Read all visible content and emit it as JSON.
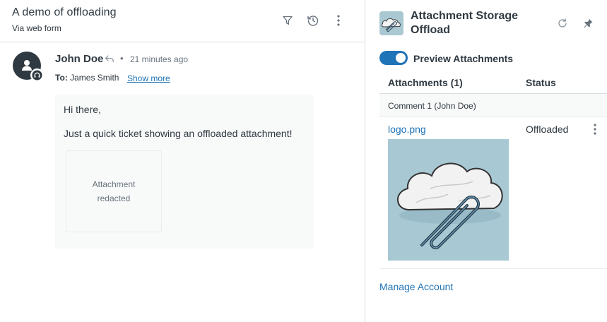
{
  "ticket": {
    "title": "A demo of offloading",
    "subtitle": "Via web form"
  },
  "header_icons": [
    "filter-icon",
    "history-icon",
    "more-vertical-icon"
  ],
  "comment": {
    "author": "John Doe",
    "separator": "•",
    "time": "21 minutes ago",
    "to_label": "To:",
    "to_value": "James Smith",
    "show_more": "Show more",
    "body_lines": [
      "Hi there,",
      "Just a quick ticket showing an offloaded attachment!"
    ],
    "attachment_placeholder": "Attachment redacted"
  },
  "app": {
    "title": "Attachment Storage Offload",
    "toggle_label": "Preview Attachments",
    "toggle_on": true,
    "columns": [
      "Attachments (1)",
      "Status"
    ],
    "group_label": "Comment 1 (John Doe)",
    "file_name": "logo.png",
    "file_status": "Offloaded",
    "manage_link": "Manage Account"
  },
  "colors": {
    "accent": "#1f73b7",
    "text": "#2f3941",
    "muted": "#68737d",
    "border": "#d8dcde",
    "panel_bg": "#f8f9f9",
    "preview_bg": "#a8c8d3"
  }
}
